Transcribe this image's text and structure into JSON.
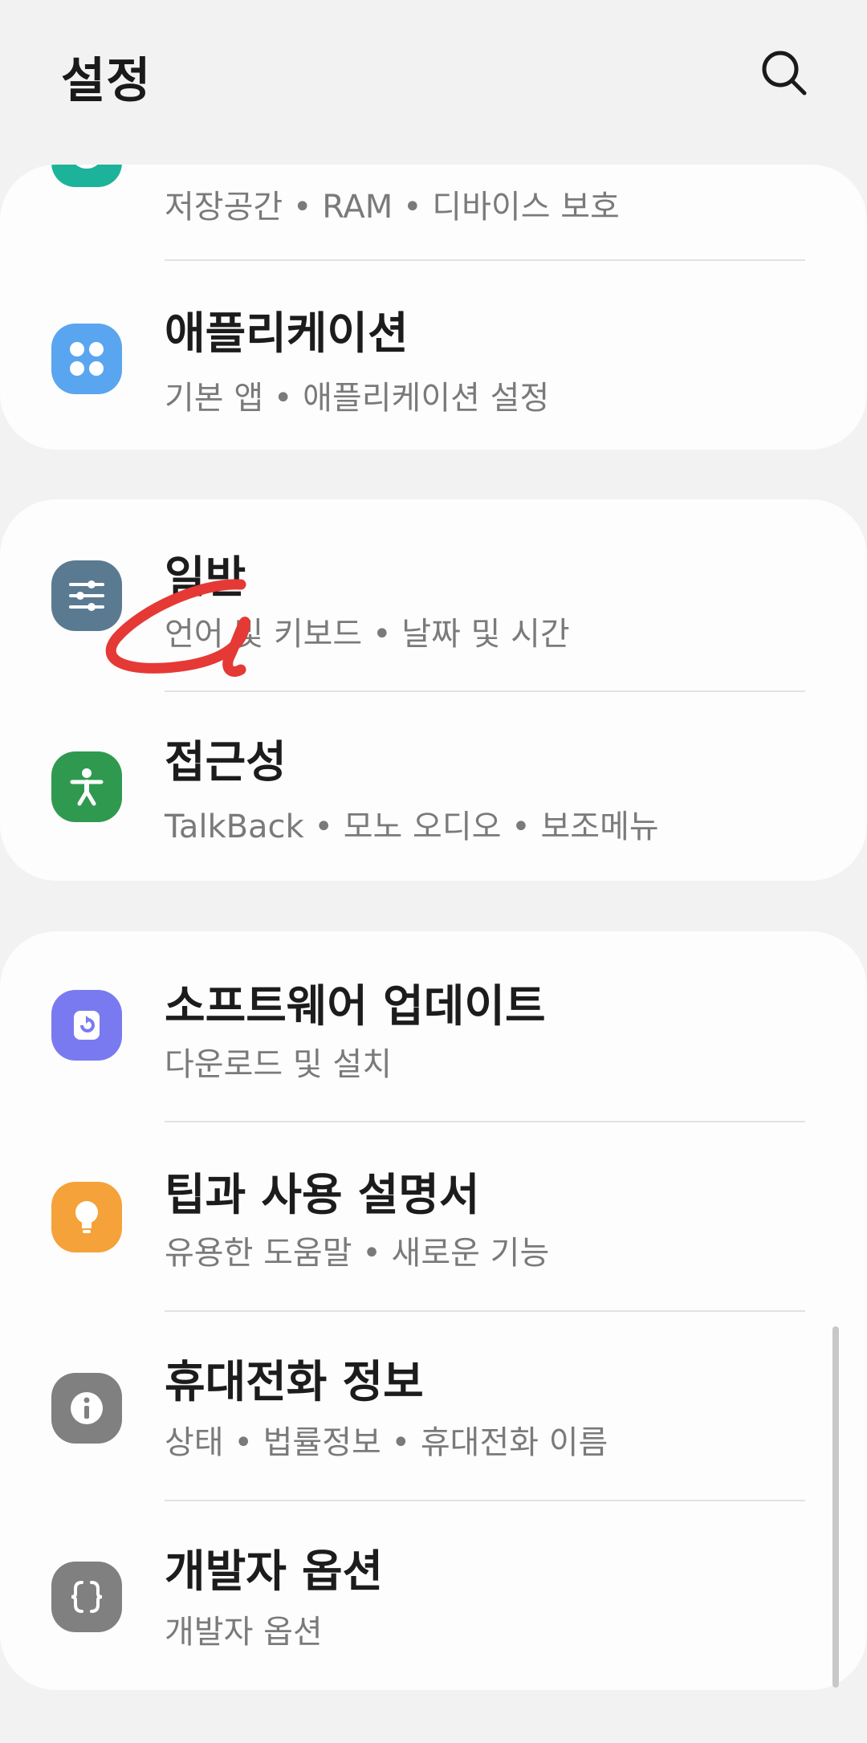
{
  "header": {
    "title": "설정",
    "search_icon": "search-icon"
  },
  "cards": [
    {
      "items": [
        {
          "label": "",
          "sub": "저장공간 • RAM • 디바이스 보호",
          "icon": "device-care-icon",
          "color": "#1db39a"
        },
        {
          "label": "애플리케이션",
          "sub": "기본 앱 • 애플리케이션 설정",
          "icon": "apps-icon",
          "color": "#5aa5f0"
        }
      ]
    },
    {
      "items": [
        {
          "label": "일반",
          "sub": "언어 및 키보드 • 날짜 및 시간",
          "icon": "sliders-icon",
          "color": "#5a7a91"
        },
        {
          "label": "접근성",
          "sub": "TalkBack • 모노 오디오 • 보조메뉴",
          "icon": "accessibility-icon",
          "color": "#2f9a4f"
        }
      ]
    },
    {
      "items": [
        {
          "label": "소프트웨어 업데이트",
          "sub": "다운로드 및 설치",
          "icon": "software-update-icon",
          "color": "#7a7af0"
        },
        {
          "label": "팁과 사용 설명서",
          "sub": "유용한 도움말 • 새로운 기능",
          "icon": "lightbulb-icon",
          "color": "#f5a23a"
        },
        {
          "label": "휴대전화 정보",
          "sub": "상태 • 법률정보 • 휴대전화 이름",
          "icon": "info-icon",
          "color": "#808080"
        },
        {
          "label": "개발자 옵션",
          "sub": "개발자 옵션",
          "icon": "developer-options-icon",
          "color": "#808080"
        }
      ]
    }
  ],
  "annotation": {
    "color": "#e53935"
  }
}
